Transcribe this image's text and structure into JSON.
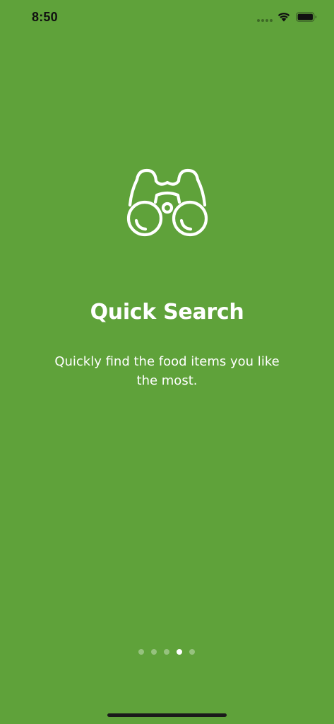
{
  "theme": {
    "background": "#5fa23a",
    "text": "#ffffff"
  },
  "status_bar": {
    "time": "8:50",
    "icons": [
      "cellular-signal-icon",
      "wifi-icon",
      "battery-icon"
    ]
  },
  "onboarding": {
    "icon": "binoculars-icon",
    "title": "Quick Search",
    "description": "Quickly find the food items you like the most."
  },
  "pager": {
    "total_pages": 5,
    "current_page": 4
  }
}
